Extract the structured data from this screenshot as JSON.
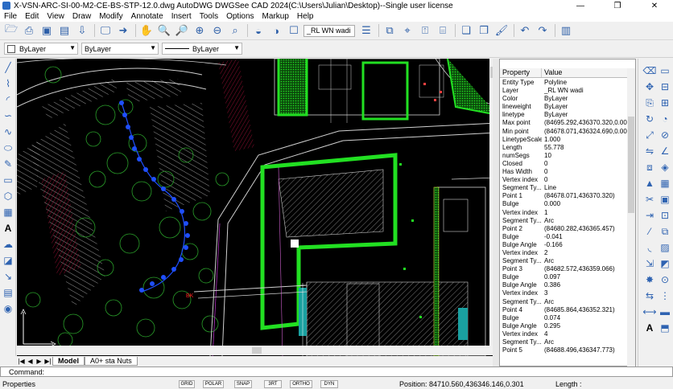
{
  "window": {
    "title": "X-VSN-ARC-SI-00-M2-CE-BS-STP-12.0.dwg AutoDWG DWGSee CAD 2024(C:\\Users\\Julian\\Desktop)--Single user license",
    "minimize": "—",
    "restore": "❐",
    "close": "✕"
  },
  "menu": [
    "File",
    "Edit",
    "View",
    "Draw",
    "Modify",
    "Annotate",
    "Insert",
    "Tools",
    "Options",
    "Markup",
    "Help"
  ],
  "toolbar": {
    "layer_value": "_RL WN wadi"
  },
  "props_toolbar": {
    "color": "ByLayer",
    "layer": "ByLayer",
    "linetype": "ByLayer"
  },
  "properties": {
    "header_property": "Property",
    "header_value": "Value",
    "rows": [
      [
        "Entity Type",
        "Polyline"
      ],
      [
        "Layer",
        "_RL WN wadi"
      ],
      [
        "Color",
        "ByLayer"
      ],
      [
        "lineweight",
        "ByLayer"
      ],
      [
        "linetype",
        "ByLayer"
      ],
      [
        "Max point",
        "(84695.292,436370.320,0.000)"
      ],
      [
        "Min point",
        "(84678.071,436324.690,0.000)"
      ],
      [
        "LinetypeScale",
        "1.000"
      ],
      [
        "Length",
        "55.778"
      ],
      [
        "numSegs",
        "10"
      ],
      [
        "Closed",
        "0"
      ],
      [
        "Has Width",
        "0"
      ],
      [
        "Vertex index",
        "0"
      ],
      [
        "Segment Ty...",
        "Line"
      ],
      [
        "Point 1",
        "(84678.071,436370.320)"
      ],
      [
        "Bulge",
        "0.000"
      ],
      [
        "Vertex index",
        "1"
      ],
      [
        "Segment Ty...",
        "Arc"
      ],
      [
        "Point 2",
        "(84680.282,436365.457)"
      ],
      [
        "Bulge",
        "-0.041"
      ],
      [
        "Bulge Angle",
        "-0.166"
      ],
      [
        "Vertex index",
        "2"
      ],
      [
        "Segment Ty...",
        "Arc"
      ],
      [
        "Point 3",
        "(84682.572,436359.066)"
      ],
      [
        "Bulge",
        "0.097"
      ],
      [
        "Bulge Angle",
        "0.386"
      ],
      [
        "Vertex index",
        "3"
      ],
      [
        "Segment Ty...",
        "Arc"
      ],
      [
        "Point 4",
        "(84685.864,436352.321)"
      ],
      [
        "Bulge",
        "0.074"
      ],
      [
        "Bulge Angle",
        "0.295"
      ],
      [
        "Vertex index",
        "4"
      ],
      [
        "Segment Ty...",
        "Arc"
      ],
      [
        "Point 5",
        "(84688.496,436347.773)"
      ]
    ]
  },
  "tabs": {
    "model": "Model",
    "layout": "A0+ sta Nuts"
  },
  "command": {
    "label": "Command:"
  },
  "status": {
    "left": "Properties",
    "buttons": [
      "GRID",
      "POLAR",
      "SNAP",
      "3RT",
      "ORTHO",
      "DYN"
    ],
    "position": "Position: 84710.560,436346.146,0.301",
    "length": "Length :"
  },
  "canvas": {
    "label_bk": "BK"
  },
  "colors": {
    "canvas_bg": "#000000",
    "hatch_green": "#22e022",
    "tree_green": "#2aa02a",
    "accent_blue": "#2d5fa8",
    "polyline_blue": "#1f4fff"
  }
}
